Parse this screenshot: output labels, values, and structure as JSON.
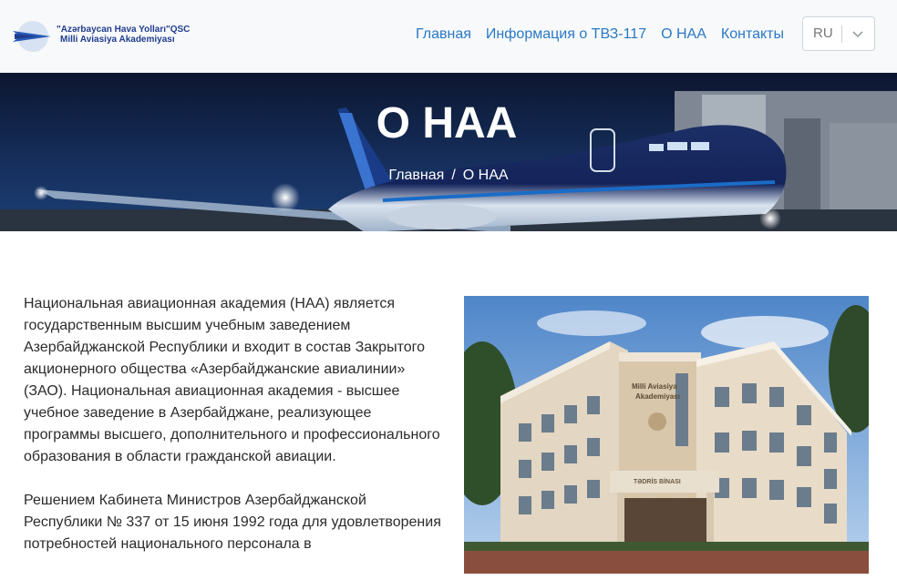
{
  "header": {
    "logo": {
      "line1": "\"Azərbaycan Hava Yolları\"QSC",
      "line2": "Milli Aviasiya Akademiyası"
    },
    "nav": [
      {
        "label": "Главная"
      },
      {
        "label": "Информация о ТВЗ-117"
      },
      {
        "label": "О НАА"
      },
      {
        "label": "Контакты"
      }
    ],
    "language": {
      "value": "RU"
    }
  },
  "hero": {
    "title": "О НАА",
    "breadcrumb": {
      "home": "Главная",
      "separator": "/",
      "current": "О НАА"
    }
  },
  "content": {
    "paragraphs": [
      "Национальная авиационная академия (НАА) является государственным высшим учебным заведением Азербайджанской Республики и входит в состав Закрытого акционерного общества «Азербайджанские авиалинии» (ЗАО). Национальная авиационная академия - высшее учебное заведение в Азербайджане, реализующее программы высшего, дополнительного и профессионального образования в области гражданской авиации.",
      "Решением Кабинета Министров Азербайджанской Республики № 337 от 15 июня 1992 года для удовлетворения потребностей национального персонала в"
    ],
    "photo": {
      "sign_line1": "Milli Aviasiya",
      "sign_line2": "Akademiyası",
      "entrance": "TƏDRİS BİNASI"
    }
  },
  "colors": {
    "nav_link": "#2a78c5",
    "logo_text": "#1f3c8f",
    "header_bg": "#f8f9fa",
    "hero_bg": "#0b1a3a"
  }
}
